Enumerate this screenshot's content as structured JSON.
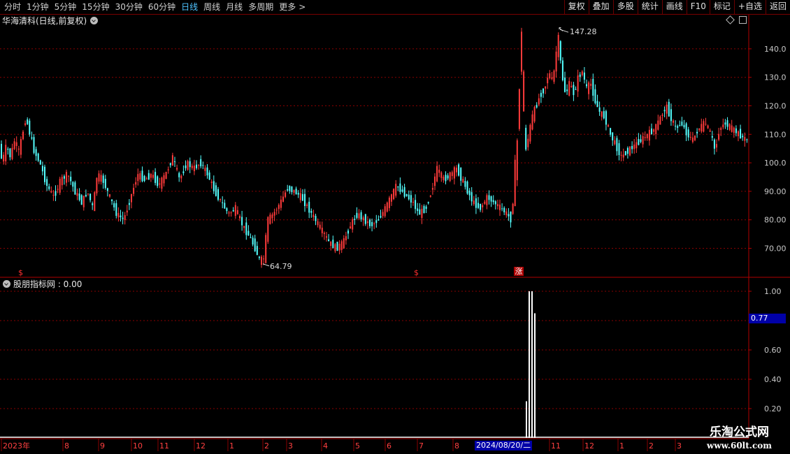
{
  "toolbar": {
    "periods": [
      "分时",
      "1分钟",
      "5分钟",
      "15分钟",
      "30分钟",
      "60分钟",
      "日线",
      "周线",
      "月线",
      "多周期",
      "更多"
    ],
    "active_period": "日线",
    "more_arrow": ">",
    "tools": [
      "复权",
      "叠加",
      "多股",
      "统计",
      "画线",
      "F10",
      "标记",
      "+自选",
      "返回"
    ]
  },
  "stock": {
    "title": "华海清科(日线,前复权)"
  },
  "indicator": {
    "title": "股朋指标网 : 0.00",
    "cursor_value": "0.77"
  },
  "price_axis": {
    "ticks": [
      "140.0",
      "130.0",
      "120.0",
      "110.0",
      "100.0",
      "90.00",
      "80.00",
      "70.00"
    ]
  },
  "indicator_axis": {
    "ticks": [
      "1.00",
      "0.60",
      "0.40",
      "0.20"
    ]
  },
  "annotations": {
    "high": "147.28",
    "low": "64.79",
    "signal_dollar": "$",
    "signal_zhang": "涨"
  },
  "date_axis": {
    "labels": [
      "2023年",
      "8",
      "9",
      "10",
      "11",
      "12",
      "1",
      "2",
      "3",
      "4",
      "5",
      "6",
      "7",
      "8",
      "11",
      "12",
      "1",
      "2",
      "3"
    ],
    "cursor_date": "2024/08/20/二"
  },
  "watermark": {
    "cn": "乐淘公式网",
    "url": "www.60lt.com"
  },
  "colors": {
    "up": "#ff3b3b",
    "down": "#54ffff",
    "grid": "#8a0000",
    "active": "#4fc3ff",
    "cursor_bg": "#0000a8"
  },
  "chart_data": {
    "type": "candlestick",
    "title": "华海清科(日线,前复权)",
    "ylim": [
      60,
      150
    ],
    "key_points": {
      "high": 147.28,
      "low": 64.79
    },
    "path": [
      [
        0,
        110
      ],
      [
        6,
        100
      ],
      [
        12,
        106
      ],
      [
        18,
        102
      ],
      [
        24,
        108
      ],
      [
        30,
        104
      ],
      [
        40,
        116
      ],
      [
        46,
        110
      ],
      [
        52,
        104
      ],
      [
        60,
        100
      ],
      [
        70,
        92
      ],
      [
        80,
        88
      ],
      [
        90,
        94
      ],
      [
        100,
        96
      ],
      [
        110,
        90
      ],
      [
        120,
        86
      ],
      [
        128,
        90
      ],
      [
        136,
        84
      ],
      [
        142,
        96
      ],
      [
        150,
        94
      ],
      [
        160,
        88
      ],
      [
        170,
        82
      ],
      [
        180,
        80
      ],
      [
        190,
        88
      ],
      [
        200,
        96
      ],
      [
        210,
        94
      ],
      [
        220,
        96
      ],
      [
        230,
        92
      ],
      [
        240,
        96
      ],
      [
        250,
        102
      ],
      [
        260,
        94
      ],
      [
        270,
        100
      ],
      [
        280,
        98
      ],
      [
        290,
        100
      ],
      [
        300,
        96
      ],
      [
        310,
        90
      ],
      [
        320,
        86
      ],
      [
        330,
        82
      ],
      [
        340,
        84
      ],
      [
        350,
        78
      ],
      [
        360,
        74
      ],
      [
        368,
        70
      ],
      [
        374,
        66
      ],
      [
        380,
        66
      ],
      [
        386,
        80
      ],
      [
        394,
        82
      ],
      [
        404,
        86
      ],
      [
        414,
        91
      ],
      [
        424,
        90
      ],
      [
        434,
        88
      ],
      [
        444,
        84
      ],
      [
        454,
        80
      ],
      [
        464,
        76
      ],
      [
        474,
        72
      ],
      [
        484,
        70
      ],
      [
        494,
        72
      ],
      [
        504,
        78
      ],
      [
        514,
        82
      ],
      [
        524,
        80
      ],
      [
        534,
        78
      ],
      [
        544,
        80
      ],
      [
        554,
        84
      ],
      [
        562,
        88
      ],
      [
        570,
        92
      ],
      [
        578,
        90
      ],
      [
        586,
        88
      ],
      [
        594,
        86
      ],
      [
        602,
        82
      ],
      [
        612,
        84
      ],
      [
        620,
        90
      ],
      [
        628,
        98
      ],
      [
        638,
        94
      ],
      [
        648,
        96
      ],
      [
        656,
        98
      ],
      [
        664,
        94
      ],
      [
        672,
        90
      ],
      [
        680,
        86
      ],
      [
        690,
        84
      ],
      [
        700,
        88
      ],
      [
        710,
        86
      ],
      [
        720,
        84
      ],
      [
        728,
        82
      ],
      [
        734,
        80
      ],
      [
        738,
        90
      ],
      [
        742,
        112
      ],
      [
        746,
        138
      ],
      [
        750,
        120
      ],
      [
        754,
        104
      ],
      [
        758,
        108
      ],
      [
        764,
        116
      ],
      [
        770,
        120
      ],
      [
        776,
        124
      ],
      [
        782,
        126
      ],
      [
        788,
        132
      ],
      [
        794,
        128
      ],
      [
        798,
        138
      ],
      [
        802,
        144
      ],
      [
        806,
        132
      ],
      [
        812,
        124
      ],
      [
        818,
        128
      ],
      [
        824,
        124
      ],
      [
        830,
        130
      ],
      [
        836,
        132
      ],
      [
        842,
        126
      ],
      [
        848,
        128
      ],
      [
        854,
        122
      ],
      [
        860,
        118
      ],
      [
        868,
        116
      ],
      [
        876,
        110
      ],
      [
        884,
        106
      ],
      [
        892,
        102
      ],
      [
        900,
        104
      ],
      [
        910,
        106
      ],
      [
        920,
        108
      ],
      [
        930,
        110
      ],
      [
        940,
        112
      ],
      [
        948,
        116
      ],
      [
        956,
        120
      ],
      [
        962,
        116
      ],
      [
        970,
        112
      ],
      [
        978,
        114
      ],
      [
        986,
        110
      ],
      [
        994,
        108
      ],
      [
        1002,
        112
      ],
      [
        1012,
        114
      ],
      [
        1020,
        110
      ],
      [
        1026,
        104
      ],
      [
        1032,
        112
      ],
      [
        1040,
        114
      ],
      [
        1050,
        112
      ],
      [
        1060,
        110
      ],
      [
        1070,
        108
      ]
    ],
    "indicator": {
      "name": "股朋指标网",
      "value": 0.0,
      "ylim": [
        0,
        1.05
      ],
      "spikes": [
        {
          "date": "2024/08/20",
          "value": 1.0
        }
      ]
    }
  }
}
